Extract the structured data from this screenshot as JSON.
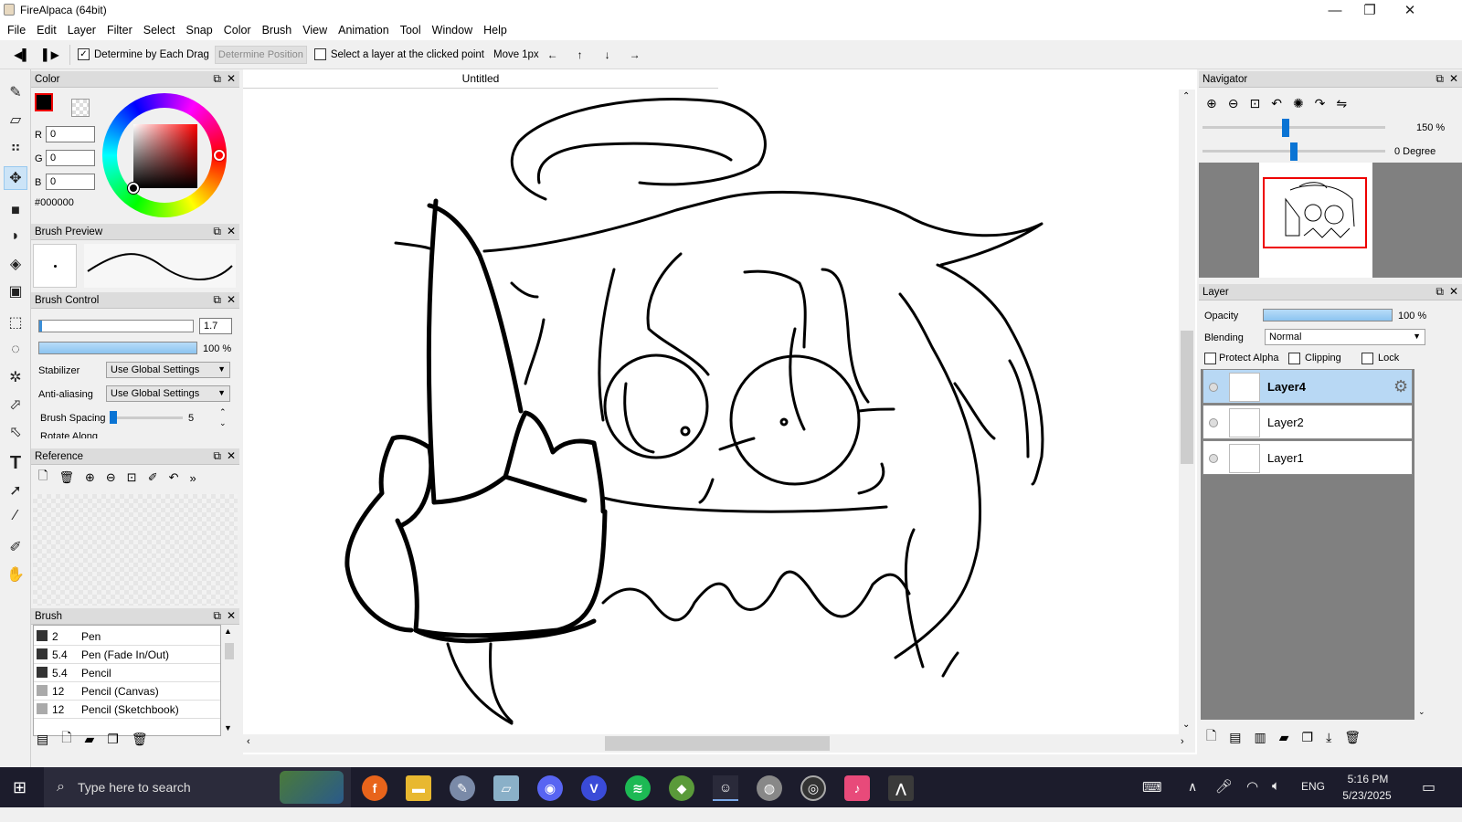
{
  "window": {
    "title": "FireAlpaca (64bit)",
    "minimize": "—",
    "maximize": "❐",
    "close": "✕"
  },
  "menu": [
    "File",
    "Edit",
    "Layer",
    "Filter",
    "Select",
    "Snap",
    "Color",
    "Brush",
    "View",
    "Animation",
    "Tool",
    "Window",
    "Help"
  ],
  "toolbar": {
    "determine_each_drag": "Determine by Each Drag",
    "determine_position": "Determine Position",
    "select_layer": "Select a layer at the clicked point",
    "move_label": "Move",
    "move_amount": "1px",
    "arrows": [
      "←",
      "↑",
      "↓",
      "→"
    ]
  },
  "color_panel": {
    "title": "Color",
    "r_label": "R",
    "r_value": "0",
    "g_label": "G",
    "g_value": "0",
    "b_label": "B",
    "b_value": "0",
    "hex": "#000000",
    "foreground": "#000000"
  },
  "brush_preview": {
    "title": "Brush Preview"
  },
  "brush_control": {
    "title": "Brush Control",
    "size": "1.7",
    "opacity": "100 %",
    "stabilizer_label": "Stabilizer",
    "stabilizer_value": "Use Global Settings",
    "antialias_label": "Anti-aliasing",
    "antialias_value": "Use Global Settings",
    "spacing_label": "Brush Spacing",
    "spacing_value": "5",
    "rotate_label": "Rotate Along"
  },
  "reference": {
    "title": "Reference"
  },
  "brush_list": {
    "title": "Brush",
    "items": [
      {
        "size": "2",
        "name": "Pen"
      },
      {
        "size": "5.4",
        "name": "Pen (Fade In/Out)"
      },
      {
        "size": "5.4",
        "name": "Pencil"
      },
      {
        "size": "12",
        "name": "Pencil (Canvas)"
      },
      {
        "size": "12",
        "name": "Pencil (Sketchbook)"
      }
    ]
  },
  "canvas": {
    "tab": "Untitled"
  },
  "navigator": {
    "title": "Navigator",
    "zoom": "150 %",
    "rotation": "0 Degree",
    "zoom_level": 0.35,
    "rotation_level": 0.5
  },
  "layer_panel": {
    "title": "Layer",
    "opacity_label": "Opacity",
    "opacity_value": "100 %",
    "blending_label": "Blending",
    "blending_value": "Normal",
    "protect_alpha": "Protect Alpha",
    "clipping": "Clipping",
    "lock": "Lock",
    "layers": [
      {
        "name": "Layer4",
        "selected": true
      },
      {
        "name": "Layer2",
        "selected": false
      },
      {
        "name": "Layer1",
        "selected": false
      }
    ]
  },
  "taskbar": {
    "search_placeholder": "Type here to search",
    "lang": "ENG",
    "time": "5:16 PM",
    "date": "5/23/2025"
  }
}
